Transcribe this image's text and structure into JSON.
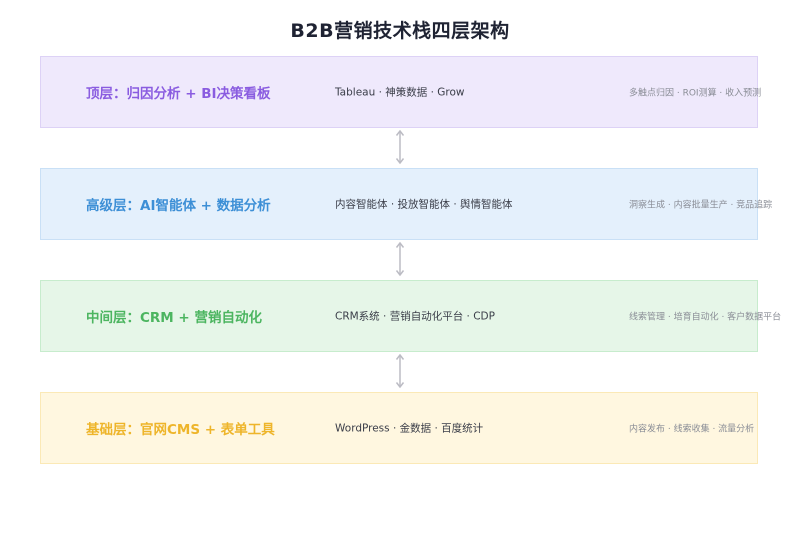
{
  "title": "B2B营销技术栈四层架构",
  "layers": [
    {
      "name": "顶层：归因分析 + BI决策看板",
      "tech": "Tableau · 神策数据 · Grow",
      "functions": "多触点归因 · ROI测算 · 收入预测",
      "bg": "#efe9fc",
      "border": "#ddd2f6",
      "color": "#8a5ce0"
    },
    {
      "name": "高级层：AI智能体 + 数据分析",
      "tech": "内容智能体 · 投放智能体 · 舆情智能体",
      "functions": "洞察生成 · 内容批量生产 · 竞品追踪",
      "bg": "#e4f0fc",
      "border": "#c9e0f6",
      "color": "#3d8fd6"
    },
    {
      "name": "中间层：CRM + 营销自动化",
      "tech": "CRM系统 · 营销自动化平台 · CDP",
      "functions": "线索管理 · 培育自动化 · 客户数据平台",
      "bg": "#e6f6e8",
      "border": "#c7eccd",
      "color": "#4cb560"
    },
    {
      "name": "基础层：官网CMS + 表单工具",
      "tech": "WordPress · 金数据 · 百度统计",
      "functions": "内容发布 · 线索收集 · 流量分析",
      "bg": "#fff7e0",
      "border": "#fbe9b6",
      "color": "#eeb52a"
    }
  ]
}
